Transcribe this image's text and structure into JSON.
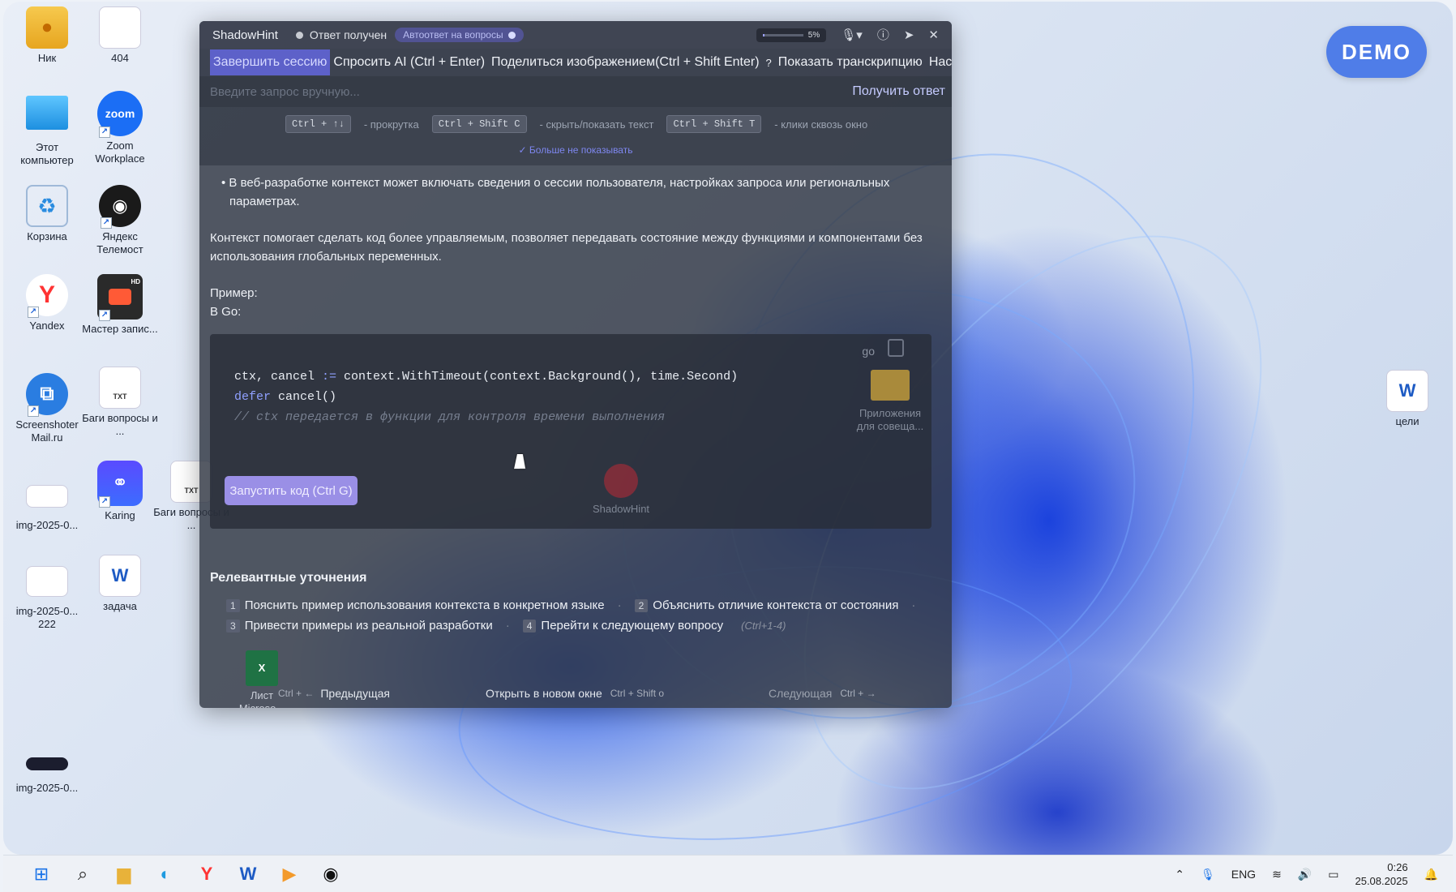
{
  "desktop": {
    "icons": [
      {
        "label": "Ник"
      },
      {
        "label": "404"
      },
      {
        "label": "Этот компьютер"
      },
      {
        "label": "Zoom Workplace"
      },
      {
        "label": "Корзина"
      },
      {
        "label": "Яндекс Телемост"
      },
      {
        "label": "Yandex"
      },
      {
        "label": "Мастер запис..."
      },
      {
        "label": "Screenshoter Mail.ru"
      },
      {
        "label": "Баги вопросы и ..."
      },
      {
        "label": "img-2025-0..."
      },
      {
        "label": "Karing"
      },
      {
        "label": "Баги вопросы и ..."
      },
      {
        "label": "img-2025-0... 222"
      },
      {
        "label": "задача"
      },
      {
        "label": "img-2025-0..."
      },
      {
        "label": "Приложения для совеща..."
      },
      {
        "label": "ShadowHint"
      },
      {
        "label": "Лист Microso..."
      },
      {
        "label": "цели"
      }
    ],
    "zoom_text": "zoom",
    "txt_text": "TXT",
    "hd_text": "HD"
  },
  "demo_badge": "DEMO",
  "window": {
    "app_name": "ShadowHint",
    "status": "Ответ получен",
    "auto_badge": "Автоответ на вопросы",
    "progress_label": "5%",
    "progress_value": 0.05,
    "menu": {
      "end_session": "Завершить сессию",
      "ask_ai": "Спросить AI (Ctrl + Enter)",
      "share_image": "Поделиться изображением(Ctrl + Shift Enter)",
      "transcript": "Показать транскрипцию",
      "settings": "Настройки"
    },
    "input_placeholder": "Введите запрос вручную...",
    "get_answer": "Получить ответ",
    "hints": {
      "k1": "Ctrl + ↑↓",
      "t1": "- прокрутка",
      "k2": "Ctrl + Shift C",
      "t2": "- скрыть/показать текст",
      "k3": "Ctrl + Shift T",
      "t3": "- клики сквозь окно",
      "dont_show": "✓ Больше не показывать"
    },
    "content": {
      "bullet": "• В веб-разработке контекст может включать сведения о сессии пользователя, настройках запроса или региональных параметрах.",
      "para": "Контекст помогает сделать код более управляемым, позволяет передавать состояние между функциями и компонентами без использования глобальных переменных.",
      "example": "Пример:",
      "in_go": "В Go:"
    },
    "code": {
      "lang": "go",
      "line1_vars": "ctx, cancel ",
      "line1_op": ":=",
      "line1_rest": " context.WithTimeout(context.Background(), time.Second)",
      "line2_kw": "defer",
      "line2_rest": " cancel()",
      "line3": "// ctx передается в функции для контроля времени выполнения",
      "run_button": "Запустить код (Ctrl G)"
    },
    "relevant": {
      "title": "Релевантные уточнения",
      "items": [
        {
          "num": "1",
          "text": "Пояснить пример использования контекста в конкретном языке"
        },
        {
          "num": "2",
          "text": "Объяснить отличие контекста от состояния"
        },
        {
          "num": "3",
          "text": "Привести примеры из реальной разработки"
        },
        {
          "num": "4",
          "text": "Перейти к следующему вопросу"
        }
      ],
      "shortcut": "(Ctrl+1-4)"
    },
    "footer": {
      "prev_key": "Ctrl + ←",
      "prev": "Предыдущая",
      "open_new": "Открыть в новом окне",
      "open_key": "Ctrl + Shift o",
      "next": "Следующая",
      "next_key": "Ctrl + →"
    }
  },
  "taskbar": {
    "lang": "ENG",
    "time": "0:26",
    "date": "25.08.2025"
  }
}
